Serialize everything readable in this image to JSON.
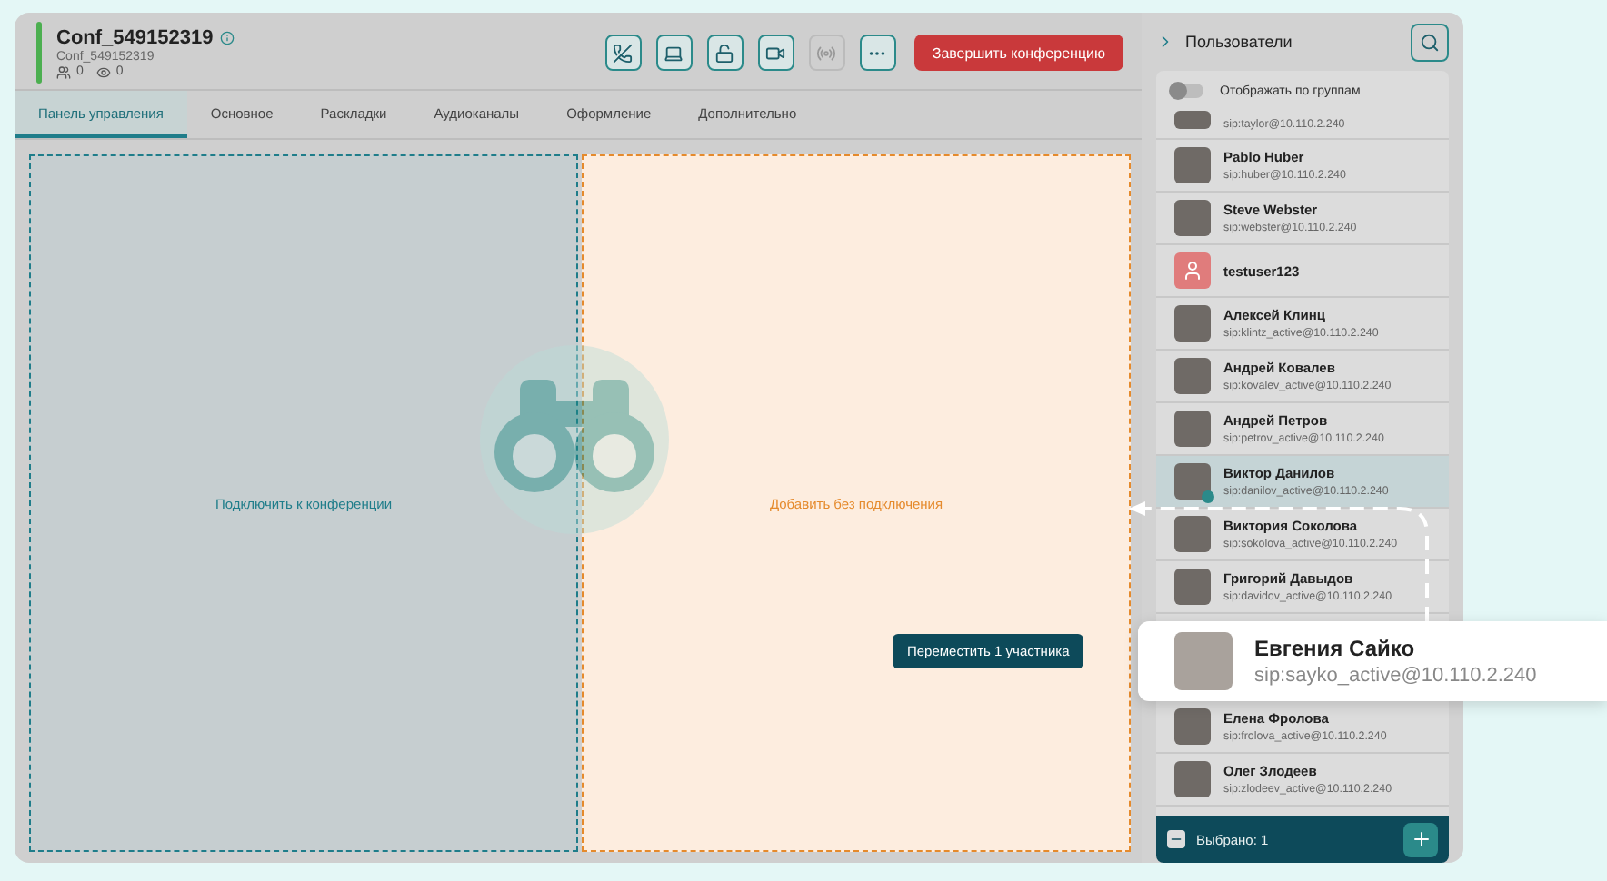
{
  "conference": {
    "title": "Conf_549152319",
    "subtitle": "Conf_549152319",
    "participants": "0",
    "viewers": "0",
    "end_button": "Завершить конференцию"
  },
  "toolbar": [
    {
      "kind": "phone",
      "disabled": false
    },
    {
      "kind": "laptop",
      "disabled": false
    },
    {
      "kind": "lock",
      "disabled": false
    },
    {
      "kind": "video",
      "disabled": false
    },
    {
      "kind": "broadcast",
      "disabled": true
    },
    {
      "kind": "more",
      "disabled": false
    }
  ],
  "tabs": [
    {
      "label": "Панель управления",
      "selected": true
    },
    {
      "label": "Основное",
      "selected": false
    },
    {
      "label": "Раскладки",
      "selected": false
    },
    {
      "label": "Аудиоканалы",
      "selected": false
    },
    {
      "label": "Оформление",
      "selected": false
    },
    {
      "label": "Дополнительно",
      "selected": false
    }
  ],
  "drop_zones": {
    "connect": "Подключить к конференции",
    "add": "Добавить без подключения"
  },
  "move_button": "Переместить 1 участника",
  "sidebar": {
    "title": "Пользователи",
    "group_toggle": {
      "label": "Отображать по группам",
      "on": false
    },
    "users": [
      {
        "kind": "photo",
        "sip": "sip:taylor@10.110.2.240",
        "selected": false
      },
      {
        "kind": "photo",
        "name": "Pablo Huber",
        "sip": "sip:huber@10.110.2.240",
        "selected": false
      },
      {
        "kind": "photo",
        "name": "Steve Webster",
        "sip": "sip:webster@10.110.2.240",
        "selected": false
      },
      {
        "kind": "generic",
        "name": "testuser123",
        "selected": false
      },
      {
        "kind": "photo",
        "name": "Алексей Клинц",
        "sip": "sip:klintz_active@10.110.2.240",
        "selected": false
      },
      {
        "kind": "photo",
        "name": "Андрей Ковалев",
        "sip": "sip:kovalev_active@10.110.2.240",
        "selected": false
      },
      {
        "kind": "photo",
        "name": "Андрей Петров",
        "sip": "sip:petrov_active@10.110.2.240",
        "selected": false
      },
      {
        "kind": "photo",
        "name": "Виктор Данилов",
        "sip": "sip:danilov_active@10.110.2.240",
        "selected": true
      },
      {
        "kind": "photo",
        "name": "Виктория Соколова",
        "sip": "sip:sokolova_active@10.110.2.240",
        "selected": false
      },
      {
        "kind": "photo",
        "name": "Григорий Давыдов",
        "sip": "sip:davidov_active@10.110.2.240",
        "selected": false
      },
      {
        "kind": "photo",
        "name": "Елена Фролова",
        "sip": "sip:frolova_active@10.110.2.240",
        "selected": false
      },
      {
        "kind": "photo",
        "name": "Олег Злодеев",
        "sip": "sip:zlodeev_active@10.110.2.240",
        "selected": false
      }
    ],
    "partially_selected": true,
    "selected_count": "Выбрано: 1"
  },
  "drag_card": {
    "name": "Евгения Сайко",
    "sip": "sip:sayko_active@10.110.2.240"
  }
}
